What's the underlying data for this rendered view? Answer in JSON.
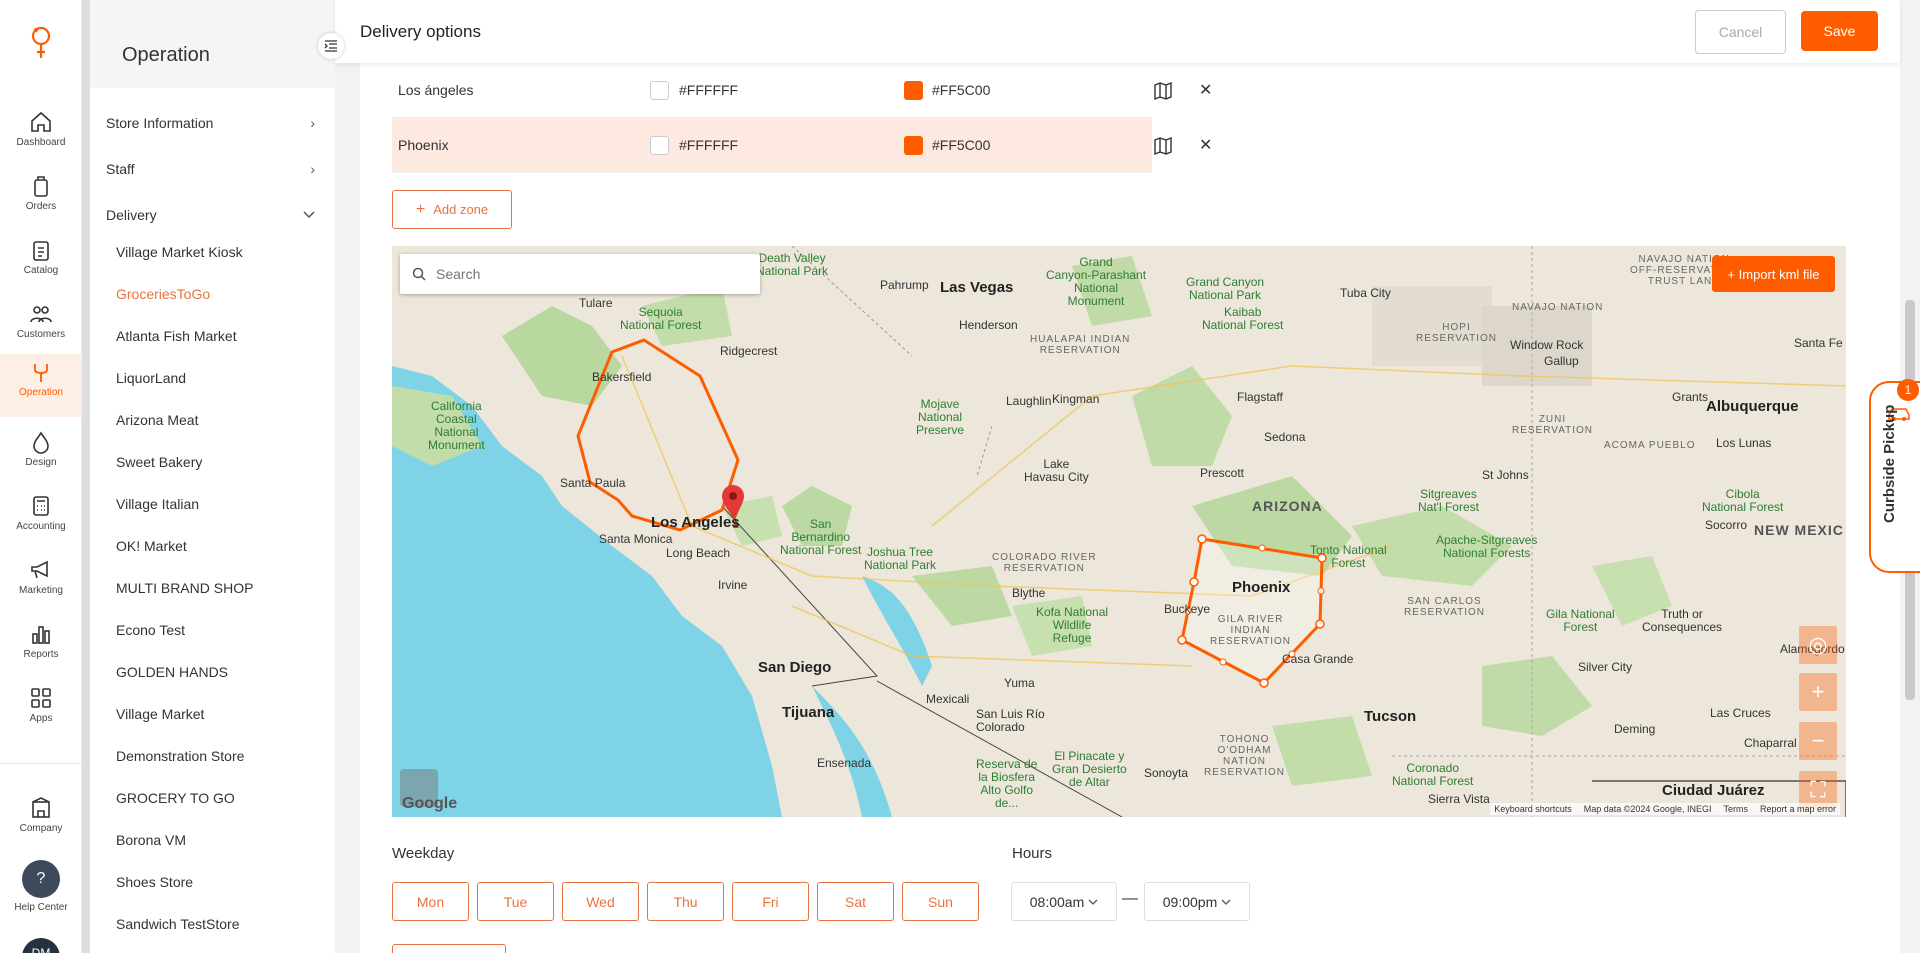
{
  "rail": {
    "items": [
      {
        "label": "Dashboard",
        "icon": "home-icon"
      },
      {
        "label": "Orders",
        "icon": "bag-icon"
      },
      {
        "label": "Catalog",
        "icon": "clipboard-icon"
      },
      {
        "label": "Customers",
        "icon": "people-icon"
      },
      {
        "label": "Operation",
        "icon": "operation-icon",
        "active": true
      },
      {
        "label": "Design",
        "icon": "drop-icon"
      },
      {
        "label": "Accounting",
        "icon": "calculator-icon"
      },
      {
        "label": "Marketing",
        "icon": "megaphone-icon"
      },
      {
        "label": "Reports",
        "icon": "bars-icon"
      },
      {
        "label": "Apps",
        "icon": "grid-icon"
      }
    ],
    "company": "Company",
    "help_center": "Help Center",
    "help_symbol": "?",
    "avatar_initials": "DM"
  },
  "sidebar": {
    "title": "Operation",
    "menu": [
      {
        "label": "Store Information",
        "chevron": ">"
      },
      {
        "label": "Staff",
        "chevron": ">"
      },
      {
        "label": "Delivery",
        "chevron": "v"
      }
    ],
    "stores": [
      "Village Market Kiosk",
      "GroceriesToGo",
      "Atlanta Fish Market",
      "LiquorLand",
      "Arizona Meat",
      "Sweet Bakery",
      "Village Italian",
      "OK! Market",
      "MULTI BRAND SHOP",
      "Econo Test",
      "GOLDEN HANDS",
      "Village Market",
      "Demonstration Store",
      "GROCERY TO GO",
      "Borona VM",
      "Shoes Store",
      "Sandwich TestStore"
    ],
    "active_store": "GroceriesToGo"
  },
  "header": {
    "title": "Delivery options",
    "cancel": "Cancel",
    "save": "Save"
  },
  "zones": [
    {
      "name": "Los ángeles",
      "fill": "#FFFFFF",
      "stroke": "#FF5C00"
    },
    {
      "name": "Phoenix",
      "fill": "#FFFFFF",
      "stroke": "#FF5C00"
    }
  ],
  "zone_stroke_label": "#FF5C00",
  "add_zone": "Add zone",
  "map": {
    "search_placeholder": "Search",
    "import_kml": "+ Import kml file",
    "footer": {
      "shortcuts": "Keyboard shortcuts",
      "data": "Map data ©2024 Google, INEGI",
      "terms": "Terms",
      "report": "Report a map error"
    },
    "google": "Google",
    "labels": {
      "las_vegas": "Las Vegas",
      "henderson": "Henderson",
      "pahrump": "Pahrump",
      "los_angeles": "Los Angeles",
      "long_beach": "Long Beach",
      "irvine": "Irvine",
      "santa_monica": "Santa Monica",
      "santa_paula": "Santa Paula",
      "bakersfield": "Bakersfield",
      "ridgecrest": "Ridgecrest",
      "tulare": "Tulare",
      "san_diego": "San Diego",
      "tijuana": "Tijuana",
      "mexicali": "Mexicali",
      "yuma": "Yuma",
      "ensenada": "Ensenada",
      "san_luis": "San Luis Río\nColorado",
      "phoenix": "Phoenix",
      "buckeye": "Buckeye",
      "casa_grande": "Casa Grande",
      "tucson": "Tucson",
      "flagstaff": "Flagstaff",
      "sedona": "Sedona",
      "prescott": "Prescott",
      "kingman": "Kingman",
      "laughlin": "Laughlin",
      "lake_havasu": "Lake\nHavasu City",
      "blythe": "Blythe",
      "albuquerque": "Albuquerque",
      "santa_fe": "Santa Fe",
      "grants": "Grants",
      "gallup": "Gallup",
      "window_rock": "Window Rock",
      "tuba_city": "Tuba City",
      "los_lunas": "Los Lunas",
      "st_johns": "St Johns",
      "socorro": "Socorro",
      "silver_city": "Silver City",
      "deming": "Deming",
      "las_cruces": "Las Cruces",
      "alamogordo": "Alamogordo",
      "chaparral": "Chaparral",
      "ciudad_juarez": "Ciudad Juárez",
      "sierra_vista": "Sierra Vista",
      "sonoyta": "Sonoyta",
      "truth": "Truth or\nConsequences",
      "arizona": "ARIZONA",
      "new_mexico": "NEW MEXIC",
      "sequoia": "Sequoia\nNational Forest",
      "death_valley": "Death Valley\nNational Park",
      "grand_canyon_parashant": "Grand\nCanyon-Parashant\nNational\nMonument",
      "grand_canyon_nf": "Grand Canyon\nNational Park",
      "kaibab": "Kaibab\nNational Forest",
      "mojave": "Mojave\nNational\nPreserve",
      "california_coastal": "California\nCoastal\nNational\nMonument",
      "san_bernardino": "San\nBernardino\nNational Forest",
      "joshua_tree": "Joshua Tree\nNational Park",
      "kofa": "Kofa National\nWildlife\nRefuge",
      "tonto": "Tonto National\nForest",
      "apache": "Apache-Sitgreaves\nNational Forests",
      "sitgreaves": "Sitgreaves\nNat'l Forest",
      "gila": "Gila National\nForest",
      "cibola": "Cibola\nNational Forest",
      "coronado": "Coronado\nNational Forest",
      "pinacate": "El Pinacate y\nGran Desierto\nde Altar",
      "reserva": "Reserva de\nla Biosfera\nAlto Golfo\nde...",
      "hualapai": "HUALAPAI INDIAN\nRESERVATION",
      "hopi": "HOPI\nRESERVATION",
      "navajo": "NAVAJO NATION",
      "navajo_off": "NAVAJO NATION\nOFF-RESERVATION\nTRUST LAND",
      "zuni": "ZUNI\nRESERVATION",
      "acoma": "ACOMA PUEBLO",
      "colorado_river": "COLORADO RIVER\nRESERVATION",
      "gila_river": "GILA RIVER\nINDIAN\nRESERVATION",
      "san_carlos": "SAN CARLOS\nRESERVATION",
      "tohono": "TOHONO\nO'ODHAM\nNATION\nRESERVATION"
    }
  },
  "curbside": {
    "label": "Curbside Pickup",
    "count": "1"
  },
  "schedule": {
    "weekday_label": "Weekday",
    "hours_label": "Hours",
    "days": [
      "Mon",
      "Tue",
      "Wed",
      "Thu",
      "Fri",
      "Sat",
      "Sun"
    ],
    "open": "08:00am",
    "close": "09:00pm",
    "separator": "—"
  }
}
